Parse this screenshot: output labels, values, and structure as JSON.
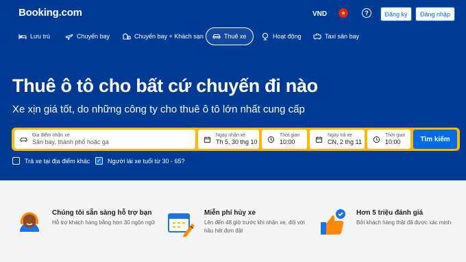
{
  "header": {
    "logo": "Booking.com",
    "currency": "VND",
    "help_glyph": "?",
    "register_label": "Đăng ký",
    "login_label": "Đăng nhập"
  },
  "nav": [
    {
      "label": "Lưu trú",
      "icon": "bed-icon"
    },
    {
      "label": "Chuyến bay",
      "icon": "plane-icon"
    },
    {
      "label": "Chuyến bay + Khách sạn",
      "icon": "flight-hotel-icon"
    },
    {
      "label": "Thuê xe",
      "icon": "car-icon",
      "active": true
    },
    {
      "label": "Hoạt động",
      "icon": "attractions-icon"
    },
    {
      "label": "Taxi sân bay",
      "icon": "taxi-icon"
    }
  ],
  "hero": {
    "title": "Thuê ô tô cho bất cứ chuyến đi nào",
    "subtitle": "Xe xịn giá tốt, do những công ty cho thuê ô tô lớn nhất cung cấp"
  },
  "search": {
    "pickup_location_label": "Địa điểm nhận xe",
    "pickup_location_placeholder": "Sân bay, thành phố hoặc ga",
    "pickup_date_label": "Ngày nhận xe",
    "pickup_date_value": "Th 5, 30 thg 10",
    "pickup_time_label": "Thời gian",
    "pickup_time_value": "10:00",
    "dropoff_date_label": "Ngày trả xe",
    "dropoff_date_value": "CN, 2 thg 11",
    "dropoff_time_label": "Thời gian",
    "dropoff_time_value": "10:00",
    "submit_label": "Tìm kiếm",
    "different_return_label": "Trả xe tại địa điểm khác",
    "different_return_checked": false,
    "driver_age_label": "Người lái xe tuổi từ 30 - 65?",
    "driver_age_checked": true
  },
  "features": [
    {
      "title": "Chúng tôi sẵn sàng hỗ trợ bạn",
      "desc": "Hỗ trợ khách hàng bằng hơn 30 ngôn ngữ",
      "icon": "support-agent-icon"
    },
    {
      "title": "Miễn phí hủy xe",
      "desc": "Lên đến 48 giờ trước khi nhận xe, đối với hầu hết đơn đặt",
      "icon": "calendar-cancel-icon"
    },
    {
      "title": "Hơn 5 triệu đánh giá",
      "desc": "Bởi khách hàng thật đã được xác minh",
      "icon": "thumbs-up-icon"
    }
  ],
  "colors": {
    "brand_blue": "#003b95",
    "accent_blue": "#006ce4",
    "search_yellow": "#ffb700",
    "flag_red": "#da251d"
  }
}
